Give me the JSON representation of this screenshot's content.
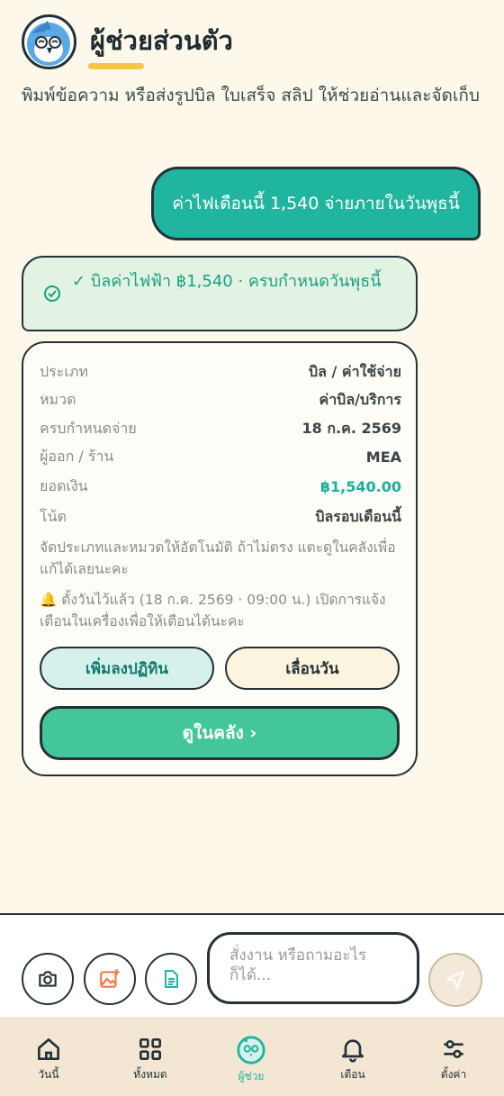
{
  "header": {
    "title": "ผู้ช่วยส่วนตัว",
    "subtitle": "พิมพ์ข้อความ หรือส่งรูปบิล ใบเสร็จ สลิป ให้ช่วยอ่านและจัดเก็บ"
  },
  "chat": {
    "user_message": "ค่าไฟเดือนนี้ 1,540 จ่ายภายในวันพุธนี้",
    "summary": "✓ บิลค่าไฟฟ้า ฿1,540 · ครบกำหนดวันพุธนี้"
  },
  "card": {
    "rows": [
      {
        "label": "ประเภท",
        "value": "บิล / ค่าใช้จ่าย"
      },
      {
        "label": "หมวด",
        "value": "ค่าบิล/บริการ"
      },
      {
        "label": "ครบกำหนดจ่าย",
        "value": "18 ก.ค. 2569"
      },
      {
        "label": "ผู้ออก / ร้าน",
        "value": "MEA"
      },
      {
        "label": "ยอดเงิน",
        "value": "฿1,540.00"
      },
      {
        "label": "โน้ต",
        "value": "บิลรอบเดือนนี้"
      }
    ],
    "note": "จัดประเภทและหมวดให้อัตโนมัติ ถ้าไม่ตรง แตะดูในคลังเพื่อแก้ได้เลยนะคะ",
    "reminder_icon": "🔔",
    "reminder": "ตั้งวันไว้แล้ว (18 ก.ค. 2569 · 09:00 น.) เปิดการแจ้งเตือนในเครื่องเพื่อให้เตือนได้นะคะ",
    "add_calendar_label": "เพิ่มลงปฏิทิน",
    "postpone_label": "เลื่อนวัน",
    "view_library_label": "ดูในคลัง ›"
  },
  "input": {
    "placeholder": "สั่งงาน หรือถามอะไรก็ได้..."
  },
  "nav": {
    "items": [
      {
        "label": "วันนี้",
        "icon": "home-icon"
      },
      {
        "label": "ทั้งหมด",
        "icon": "grid-icon"
      },
      {
        "label": "ผู้ช่วย",
        "icon": "assistant-icon"
      },
      {
        "label": "เตือน",
        "icon": "bell-icon"
      },
      {
        "label": "ตั้งค่า",
        "icon": "settings-icon"
      }
    ]
  },
  "colors": {
    "background": "#fdf8ea",
    "accent": "#1fb59e",
    "primary_button": "#43c79a",
    "outline": "#243238",
    "highlight": "#f6c744"
  }
}
